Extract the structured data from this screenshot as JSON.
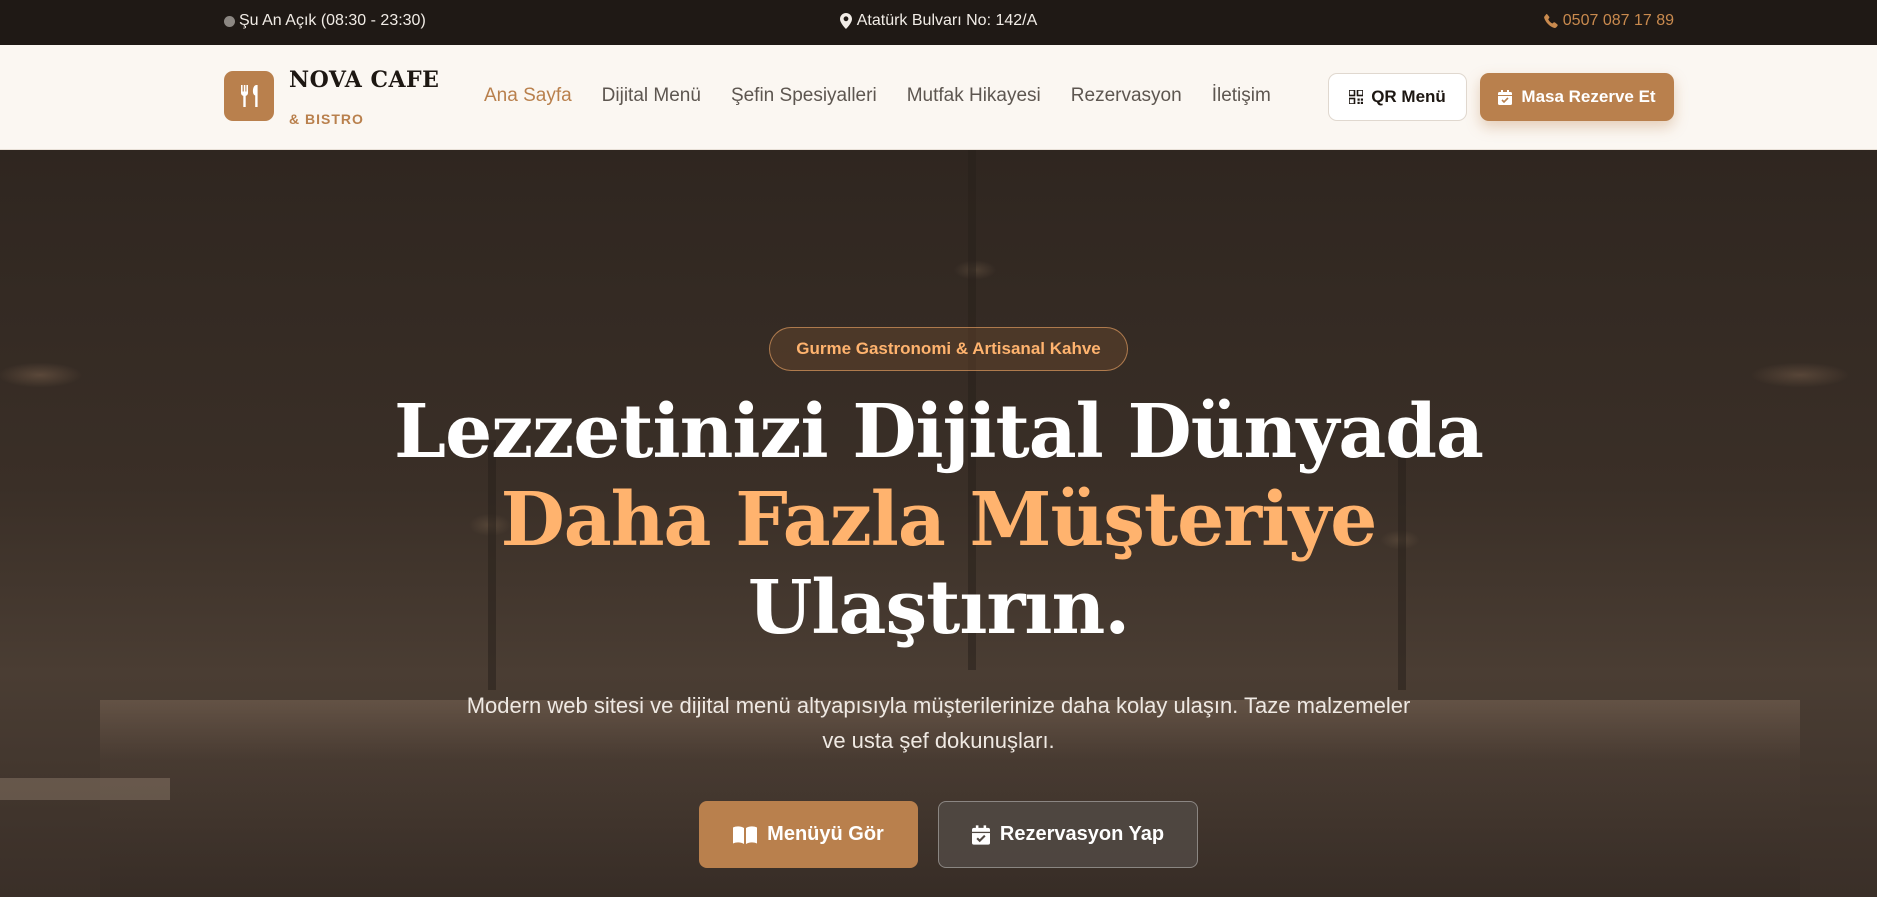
{
  "topbar": {
    "status": "Şu An Açık (08:30 - 23:30)",
    "address": "Atatürk Bulvarı No: 142/A",
    "phone": "0507 087 17 89"
  },
  "brand": {
    "name": "NOVA CAFE",
    "subtitle": "& BISTRO",
    "accent_color": "#b9804d"
  },
  "nav": {
    "items": [
      {
        "label": "Ana Sayfa",
        "active": true
      },
      {
        "label": "Dijital Menü"
      },
      {
        "label": "Şefin Spesiyalleri"
      },
      {
        "label": "Mutfak Hikayesi"
      },
      {
        "label": "Rezervasyon"
      },
      {
        "label": "İletişim"
      }
    ]
  },
  "header_actions": {
    "qr_label": "QR Menü",
    "reserve_label": "Masa Rezerve Et"
  },
  "hero": {
    "badge": "Gurme Gastronomi & Artisanal Kahve",
    "headline_line1": "Lezzetinizi Dijital Dünyada",
    "headline_line2": "Daha Fazla Müşteriye",
    "headline_line3": "Ulaştırın.",
    "subtext": "Modern web sitesi ve dijital menü altyapısıyla müşterilerinize daha kolay ulaşın. Taze malzemeler ve usta şef dokunuşları.",
    "cta_menu": "Menüyü Gör",
    "cta_reservation": "Rezervasyon Yap",
    "accent_text_color": "#ffb36e"
  },
  "icons": [
    "status-dot",
    "map-pin-icon",
    "phone-icon",
    "utensils-icon",
    "qr-code-icon",
    "calendar-check-icon",
    "book-open-icon"
  ]
}
